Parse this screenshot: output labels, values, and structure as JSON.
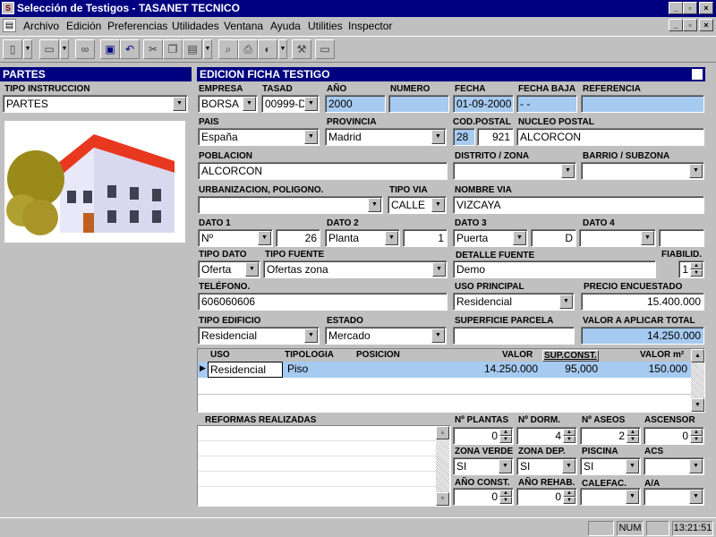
{
  "window": {
    "title": "Selección de Testigos - TASANET TECNICO"
  },
  "menu": [
    "Archivo",
    "Edición",
    "Preferencias",
    "Utilidades",
    "Ventana",
    "Ayuda",
    "Utilities",
    "Inspector"
  ],
  "left_panel": {
    "header": "PARTES",
    "tipo_instruccion_label": "TIPO INSTRUCCION",
    "tipo_instruccion_value": "PARTES"
  },
  "form": {
    "header": "EDICION FICHA TESTIGO",
    "empresa": {
      "label": "EMPRESA",
      "value": "BORSA"
    },
    "tasad": {
      "label": "TASAD",
      "value": "00999-D"
    },
    "anio": {
      "label": "AÑO",
      "value": "2000"
    },
    "numero": {
      "label": "NUMERO",
      "value": ""
    },
    "fecha": {
      "label": "FECHA",
      "value": "01-09-2000"
    },
    "fecha_baja": {
      "label": "FECHA BAJA",
      "value": "-  -"
    },
    "referencia": {
      "label": "REFERENCIA",
      "value": ""
    },
    "pais": {
      "label": "PAIS",
      "value": "España"
    },
    "provincia": {
      "label": "PROVINCIA",
      "value": "Madrid"
    },
    "cod_postal": {
      "label": "COD.POSTAL",
      "prefix": "28",
      "value": "921"
    },
    "nucleo_postal": {
      "label": "NUCLEO POSTAL",
      "value": "ALCORCON"
    },
    "poblacion": {
      "label": "POBLACION",
      "value": "ALCORCON"
    },
    "distrito": {
      "label": "DISTRITO / ZONA",
      "value": ""
    },
    "barrio": {
      "label": "BARRIO / SUBZONA",
      "value": ""
    },
    "urbanizacion": {
      "label": "URBANIZACION, POLIGONO.",
      "value": ""
    },
    "tipo_via": {
      "label": "TIPO VIA",
      "value": "CALLE"
    },
    "nombre_via": {
      "label": "NOMBRE VIA",
      "value": "VIZCAYA"
    },
    "dato1": {
      "label": "DATO 1",
      "type": "Nº",
      "value": "26"
    },
    "dato2": {
      "label": "DATO 2",
      "type": "Planta",
      "value": "1"
    },
    "dato3": {
      "label": "DATO 3",
      "type": "Puerta",
      "value": "D"
    },
    "dato4": {
      "label": "DATO 4",
      "type": "",
      "value": ""
    },
    "tipo_dato": {
      "label": "TIPO DATO",
      "value": "Oferta"
    },
    "tipo_fuente": {
      "label": "TIPO FUENTE",
      "value": "Ofertas zona"
    },
    "detalle_fuente": {
      "label": "DETALLE FUENTE",
      "value": "Demo"
    },
    "fiabilid": {
      "label": "FIABILID.",
      "value": "1"
    },
    "telefono": {
      "label": "TELÉFONO.",
      "value": "606060606"
    },
    "uso_principal": {
      "label": "USO PRINCIPAL",
      "value": "Residencial"
    },
    "precio_encuestado": {
      "label": "PRECIO ENCUESTADO",
      "value": "15.400.000"
    },
    "tipo_edificio": {
      "label": "TIPO EDIFICIO",
      "value": "Residencial"
    },
    "estado": {
      "label": "ESTADO",
      "value": "Mercado"
    },
    "superficie_parcela": {
      "label": "SUPERFICIE PARCELA",
      "value": ""
    },
    "valor_aplicar": {
      "label": "VALOR A APLICAR TOTAL",
      "value": "14.250.000"
    }
  },
  "grid": {
    "columns": [
      "USO",
      "TIPOLOGIA",
      "POSICION",
      "VALOR",
      "SUP.CONST.",
      "VALOR m²"
    ],
    "rows": [
      {
        "uso": "Residencial",
        "tipologia": "Piso",
        "posicion": "",
        "valor": "14.250.000",
        "sup_const": "95,000",
        "valor_m2": "150.000"
      }
    ]
  },
  "reformas": {
    "label": "REFORMAS REALIZADAS"
  },
  "details": {
    "n_plantas": {
      "label": "Nº PLANTAS",
      "value": "0"
    },
    "n_dorm": {
      "label": "Nº DORM.",
      "value": "4"
    },
    "n_aseos": {
      "label": "Nº ASEOS",
      "value": "2"
    },
    "ascensor": {
      "label": "ASCENSOR",
      "value": "0"
    },
    "zona_verde": {
      "label": "ZONA VERDE",
      "value": "SI"
    },
    "zona_dep": {
      "label": "ZONA DEP.",
      "value": "SI"
    },
    "piscina": {
      "label": "PISCINA",
      "value": "SI"
    },
    "acs": {
      "label": "ACS",
      "value": ""
    },
    "anio_const": {
      "label": "AÑO CONST.",
      "value": "0"
    },
    "anio_rehab": {
      "label": "AÑO REHAB.",
      "value": "0"
    },
    "calefac": {
      "label": "CALEFAC.",
      "value": ""
    },
    "aa": {
      "label": "A/A",
      "value": ""
    }
  },
  "status": {
    "num": "NUM",
    "time": "13:21:51"
  },
  "colors": {
    "titlebar": "#000080",
    "highlight_field": "#a6caf0",
    "window_bg": "#c0c0c0"
  }
}
